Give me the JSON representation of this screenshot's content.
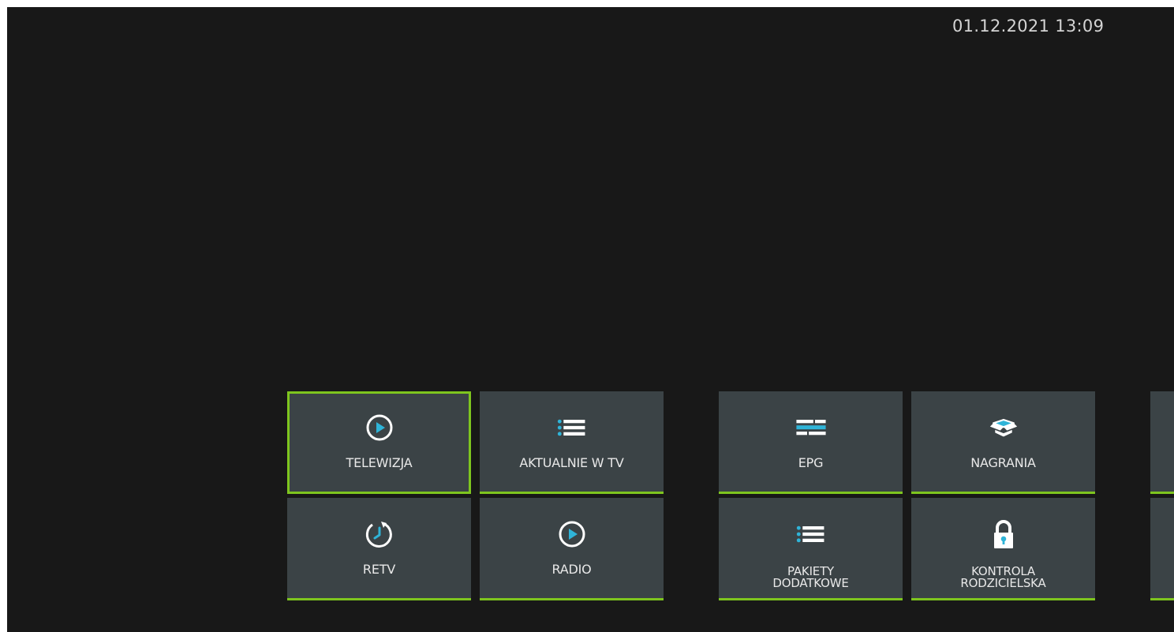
{
  "status": {
    "datetime": "01.12.2021 13:09"
  },
  "colors": {
    "accent": "#7ec51e",
    "icon_blue": "#2fb4d8",
    "tile_bg": "#3b4346",
    "screen_bg": "#181818"
  },
  "menu": {
    "tiles": [
      {
        "label": "TELEWIZJA",
        "icon": "play-circle-icon",
        "focused": true
      },
      {
        "label": "AKTUALNIE W TV",
        "icon": "list-icon",
        "focused": false
      },
      {
        "label": "EPG",
        "icon": "epg-grid-icon",
        "focused": false
      },
      {
        "label": "NAGRANIA",
        "icon": "recordings-box-icon",
        "focused": false
      },
      {
        "label": "RETV",
        "icon": "replay-clock-icon",
        "focused": false
      },
      {
        "label": "RADIO",
        "icon": "play-circle-icon",
        "focused": false
      },
      {
        "label_line1": "PAKIETY",
        "label_line2": "DODATKOWE",
        "icon": "list-icon",
        "focused": false
      },
      {
        "label_line1": "KONTROLA",
        "label_line2": "RODZICIELSKA",
        "icon": "padlock-icon",
        "focused": false
      }
    ]
  }
}
